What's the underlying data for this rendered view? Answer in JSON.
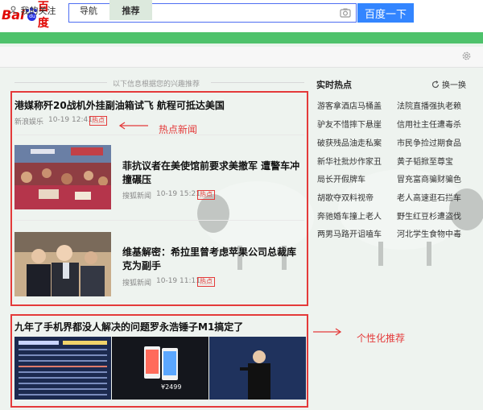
{
  "header": {
    "logo_latin": "Bai",
    "logo_paw_text": "du",
    "logo_chinese": "百度",
    "search_placeholder": "",
    "search_button": "百度一下"
  },
  "tabs": [
    {
      "label": "我的关注",
      "icon": "user-icon"
    },
    {
      "label": "导航"
    },
    {
      "label": "推荐",
      "active": true
    }
  ],
  "feed": {
    "hint": "以下信息根据您的兴趣推荐",
    "hot_news": {
      "title": "港媒称歼20战机外挂副油箱试飞 航程可抵达美国",
      "source": "新浪娱乐",
      "time": "10-19 12:41",
      "badge": "热点"
    },
    "articles": [
      {
        "title_line1": "菲抗议者在美使馆前要求美撤军 遭警车冲",
        "title_line2": "撞碾压",
        "source": "搜狐新闻",
        "time": "10-19 15:21",
        "badge": "热点"
      },
      {
        "title_line1": "维基解密：希拉里曾考虑苹果公司总裁库",
        "title_line2": "克为副手",
        "source": "搜狐新闻",
        "time": "10-19 11:11",
        "badge": "热点"
      }
    ],
    "personal": {
      "title": "九年了手机界都没人解决的问题罗永浩锤子M1搞定了",
      "price_tag": "¥2499"
    }
  },
  "annotations": {
    "hot": "热点新闻",
    "personal": "个性化推荐"
  },
  "hot_list": {
    "title": "实时热点",
    "refresh": "换一换",
    "items": [
      [
        "游客拿酒店马桶盖",
        "法院直播强执老赖"
      ],
      [
        "驴友不惜摔下悬崖",
        "信用社主任遭毒杀"
      ],
      [
        "破获残品油走私案",
        "市民争捡过期食品"
      ],
      [
        "新华社批炒作家丑",
        "黄子韬掀至尊宝"
      ],
      [
        "局长开假牌车",
        "冒充富商骗财骗色"
      ],
      [
        "胡歌夺双料视帝",
        "老人高速逛石拦车"
      ],
      [
        "奔驰婚车撞上老人",
        "野生红豆杉遭盗伐"
      ],
      [
        "两男马路开诅嗑车",
        "河北学生食物中毒"
      ]
    ]
  },
  "colors": {
    "accent": "#3385ff",
    "green_bar": "#4ec26b",
    "annotation_red": "#e43a3a",
    "badge_red": "#e43a3a"
  }
}
